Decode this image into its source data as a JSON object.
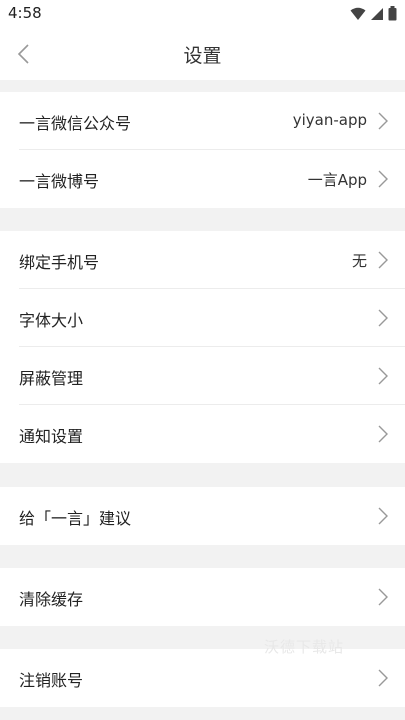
{
  "status_bar": {
    "time": "4:58",
    "icons": [
      "wifi-icon",
      "signal-icon",
      "battery-icon"
    ]
  },
  "header": {
    "title": "设置",
    "back_icon": "chevron-left-icon"
  },
  "groups": [
    {
      "items": [
        {
          "label": "一言微信公众号",
          "value": "yiyan-app"
        },
        {
          "label": "一言微博号",
          "value": "一言App"
        }
      ]
    },
    {
      "items": [
        {
          "label": "绑定手机号",
          "value": "无"
        },
        {
          "label": "字体大小",
          "value": ""
        },
        {
          "label": "屏蔽管理",
          "value": ""
        },
        {
          "label": "通知设置",
          "value": ""
        }
      ]
    },
    {
      "items": [
        {
          "label": "给「一言」建议",
          "value": ""
        }
      ]
    },
    {
      "items": [
        {
          "label": "清除缓存",
          "value": ""
        }
      ]
    },
    {
      "items": [
        {
          "label": "注销账号",
          "value": ""
        }
      ]
    }
  ],
  "watermark": "沃德下载站",
  "colors": {
    "background": "#f2f2f2",
    "surface": "#ffffff",
    "divider": "#ececec",
    "chevron": "#999999"
  }
}
